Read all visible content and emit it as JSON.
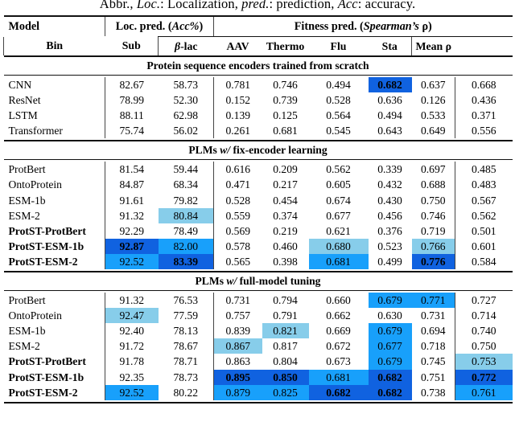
{
  "caption": {
    "text": "Abbr., Loc.: Localization, pred.: prediction, Acc: accuracy."
  },
  "table": {
    "group_headers": {
      "model": "Model",
      "loc_pred": "Loc. pred. (Acc%)",
      "fitness_pred": "Fitness pred. (Spearman's ρ)"
    },
    "columns": [
      "Model",
      "Bin",
      "Sub",
      "β-lac",
      "AAV",
      "Thermo",
      "Flu",
      "Sta",
      "Mean ρ"
    ],
    "sections": [
      {
        "title": "Protein sequence encoders trained from scratch",
        "rows": [
          {
            "model": "CNN",
            "bold": false,
            "values": [
              "82.67",
              "58.73",
              "0.781",
              "0.746",
              "0.494",
              "0.682",
              "0.637",
              "0.668"
            ],
            "highlight": [
              "",
              "",
              "",
              "",
              "",
              "dark",
              "",
              ""
            ],
            "bold_values": [
              false,
              false,
              false,
              false,
              false,
              true,
              false,
              false
            ]
          },
          {
            "model": "ResNet",
            "bold": false,
            "values": [
              "78.99",
              "52.30",
              "0.152",
              "0.739",
              "0.528",
              "0.636",
              "0.126",
              "0.436"
            ],
            "highlight": [
              "",
              "",
              "",
              "",
              "",
              "",
              "",
              ""
            ],
            "bold_values": [
              false,
              false,
              false,
              false,
              false,
              false,
              false,
              false
            ]
          },
          {
            "model": "LSTM",
            "bold": false,
            "values": [
              "88.11",
              "62.98",
              "0.139",
              "0.125",
              "0.564",
              "0.494",
              "0.533",
              "0.371"
            ],
            "highlight": [
              "",
              "",
              "",
              "",
              "",
              "",
              "",
              ""
            ],
            "bold_values": [
              false,
              false,
              false,
              false,
              false,
              false,
              false,
              false
            ]
          },
          {
            "model": "Transformer",
            "bold": false,
            "values": [
              "75.74",
              "56.02",
              "0.261",
              "0.681",
              "0.545",
              "0.643",
              "0.649",
              "0.556"
            ],
            "highlight": [
              "",
              "",
              "",
              "",
              "",
              "",
              "",
              ""
            ],
            "bold_values": [
              false,
              false,
              false,
              false,
              false,
              false,
              false,
              false
            ]
          }
        ]
      },
      {
        "title": "PLMs w/ fix-encoder learning",
        "rows": [
          {
            "model": "ProtBert",
            "bold": false,
            "values": [
              "81.54",
              "59.44",
              "0.616",
              "0.209",
              "0.562",
              "0.339",
              "0.697",
              "0.485"
            ],
            "highlight": [
              "",
              "",
              "",
              "",
              "",
              "",
              "",
              ""
            ],
            "bold_values": [
              false,
              false,
              false,
              false,
              false,
              false,
              false,
              false
            ]
          },
          {
            "model": "OntoProtein",
            "bold": false,
            "values": [
              "84.87",
              "68.34",
              "0.471",
              "0.217",
              "0.605",
              "0.432",
              "0.688",
              "0.483"
            ],
            "highlight": [
              "",
              "",
              "",
              "",
              "",
              "",
              "",
              ""
            ],
            "bold_values": [
              false,
              false,
              false,
              false,
              false,
              false,
              false,
              false
            ]
          },
          {
            "model": "ESM-1b",
            "bold": false,
            "values": [
              "91.61",
              "79.82",
              "0.528",
              "0.454",
              "0.674",
              "0.430",
              "0.750",
              "0.567"
            ],
            "highlight": [
              "",
              "",
              "",
              "",
              "",
              "",
              "",
              ""
            ],
            "bold_values": [
              false,
              false,
              false,
              false,
              false,
              false,
              false,
              false
            ]
          },
          {
            "model": "ESM-2",
            "bold": false,
            "values": [
              "91.32",
              "80.84",
              "0.559",
              "0.374",
              "0.677",
              "0.456",
              "0.746",
              "0.562"
            ],
            "highlight": [
              "",
              "light",
              "",
              "",
              "",
              "",
              "",
              ""
            ],
            "bold_values": [
              false,
              false,
              false,
              false,
              false,
              false,
              false,
              false
            ]
          },
          {
            "model": "ProtST-ProtBert",
            "bold": true,
            "values": [
              "92.29",
              "78.49",
              "0.569",
              "0.219",
              "0.621",
              "0.376",
              "0.719",
              "0.501"
            ],
            "highlight": [
              "",
              "",
              "",
              "",
              "",
              "",
              "",
              ""
            ],
            "bold_values": [
              false,
              false,
              false,
              false,
              false,
              false,
              false,
              false
            ]
          },
          {
            "model": "ProtST-ESM-1b",
            "bold": true,
            "values": [
              "92.87",
              "82.00",
              "0.578",
              "0.460",
              "0.680",
              "0.523",
              "0.766",
              "0.601"
            ],
            "highlight": [
              "dark",
              "med",
              "",
              "",
              "light",
              "",
              "light",
              ""
            ],
            "bold_values": [
              true,
              false,
              false,
              false,
              false,
              false,
              false,
              false
            ]
          },
          {
            "model": "ProtST-ESM-2",
            "bold": true,
            "values": [
              "92.52",
              "83.39",
              "0.565",
              "0.398",
              "0.681",
              "0.499",
              "0.776",
              "0.584"
            ],
            "highlight": [
              "med",
              "dark",
              "",
              "",
              "med",
              "",
              "dark",
              ""
            ],
            "bold_values": [
              false,
              true,
              false,
              false,
              false,
              false,
              true,
              false
            ]
          }
        ]
      },
      {
        "title": "PLMs w/ full-model tuning",
        "rows": [
          {
            "model": "ProtBert",
            "bold": false,
            "values": [
              "91.32",
              "76.53",
              "0.731",
              "0.794",
              "0.660",
              "0.679",
              "0.771",
              "0.727"
            ],
            "highlight": [
              "",
              "",
              "",
              "",
              "",
              "med",
              "med",
              ""
            ],
            "bold_values": [
              false,
              false,
              false,
              false,
              false,
              false,
              false,
              false
            ]
          },
          {
            "model": "OntoProtein",
            "bold": false,
            "values": [
              "92.47",
              "77.59",
              "0.757",
              "0.791",
              "0.662",
              "0.630",
              "0.731",
              "0.714"
            ],
            "highlight": [
              "light",
              "",
              "",
              "",
              "",
              "",
              "",
              ""
            ],
            "bold_values": [
              false,
              false,
              false,
              false,
              false,
              false,
              false,
              false
            ]
          },
          {
            "model": "ESM-1b",
            "bold": false,
            "values": [
              "92.40",
              "78.13",
              "0.839",
              "0.821",
              "0.669",
              "0.679",
              "0.694",
              "0.740"
            ],
            "highlight": [
              "",
              "",
              "",
              "light",
              "",
              "med",
              "",
              ""
            ],
            "bold_values": [
              false,
              false,
              false,
              false,
              false,
              false,
              false,
              false
            ]
          },
          {
            "model": "ESM-2",
            "bold": false,
            "values": [
              "91.72",
              "78.67",
              "0.867",
              "0.817",
              "0.672",
              "0.677",
              "0.718",
              "0.750"
            ],
            "highlight": [
              "",
              "",
              "light",
              "",
              "",
              "med",
              "",
              ""
            ],
            "bold_values": [
              false,
              false,
              false,
              false,
              false,
              false,
              false,
              false
            ]
          },
          {
            "model": "ProtST-ProtBert",
            "bold": true,
            "values": [
              "91.78",
              "78.71",
              "0.863",
              "0.804",
              "0.673",
              "0.679",
              "0.745",
              "0.753"
            ],
            "highlight": [
              "",
              "",
              "",
              "",
              "",
              "med",
              "",
              "light"
            ],
            "bold_values": [
              false,
              false,
              false,
              false,
              false,
              false,
              false,
              false
            ]
          },
          {
            "model": "ProtST-ESM-1b",
            "bold": true,
            "values": [
              "92.35",
              "78.73",
              "0.895",
              "0.850",
              "0.681",
              "0.682",
              "0.751",
              "0.772"
            ],
            "highlight": [
              "",
              "",
              "dark",
              "dark",
              "med",
              "dark",
              "",
              "dark"
            ],
            "bold_values": [
              false,
              false,
              true,
              true,
              false,
              true,
              false,
              true
            ]
          },
          {
            "model": "ProtST-ESM-2",
            "bold": true,
            "values": [
              "92.52",
              "80.22",
              "0.879",
              "0.825",
              "0.682",
              "0.682",
              "0.738",
              "0.761"
            ],
            "highlight": [
              "med",
              "",
              "med",
              "med",
              "dark",
              "dark",
              "",
              "med"
            ],
            "bold_values": [
              false,
              false,
              false,
              false,
              true,
              true,
              false,
              false
            ]
          }
        ]
      }
    ]
  },
  "colors": {
    "highlight_dark": "#1062e0",
    "highlight_medium": "#18a0fb",
    "highlight_light": "#87cdea",
    "rule": "#111111",
    "text": "#000000"
  }
}
